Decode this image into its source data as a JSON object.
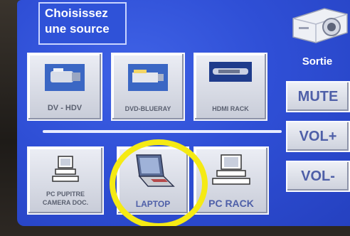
{
  "header": {
    "title_line1": "Choisissez",
    "title_line2": "une source"
  },
  "output": {
    "label": "Sortie",
    "icon": "projector-icon"
  },
  "sources_top": [
    {
      "label": "DV - HDV",
      "icon": "camcorder-icon"
    },
    {
      "label": "DVD-BLUERAY",
      "icon": "dvd-player-icon"
    },
    {
      "label": "HDMI RACK",
      "icon": "hdmi-rack-icon"
    }
  ],
  "sources_bottom": [
    {
      "label_line1": "PC PUPITRE",
      "label_line2": "CAMERA DOC.",
      "icon": "desktop-pc-icon"
    },
    {
      "label": "LAPTOP",
      "icon": "laptop-icon"
    },
    {
      "label": "PC RACK",
      "icon": "desktop-pc-icon"
    }
  ],
  "audio": {
    "mute": "MUTE",
    "vol_up": "VOL+",
    "vol_down": "VOL-"
  },
  "colors": {
    "screen": "#2f4fd6",
    "tile": "#dcdfe8",
    "highlight": "#f5ea14",
    "button_text": "#4e5fa8"
  }
}
